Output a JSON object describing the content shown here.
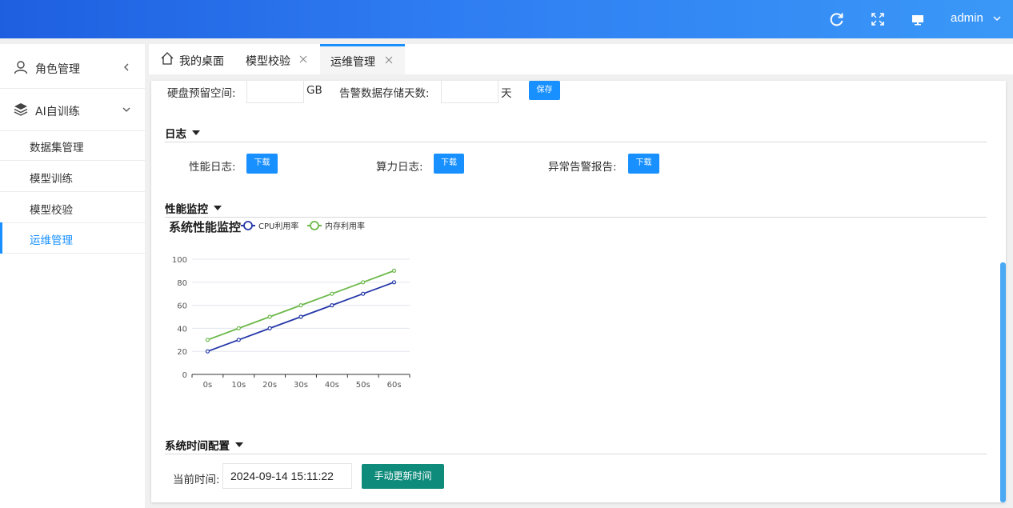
{
  "header": {
    "user": "admin",
    "icons": [
      "refresh-icon",
      "fullscreen-icon",
      "monitor-icon",
      "chevron-down-icon"
    ]
  },
  "sidebar": {
    "role_mgmt": "角色管理",
    "ai_training": "AI自训练",
    "items": [
      "数据集管理",
      "模型训练",
      "模型校验",
      "运维管理"
    ],
    "active_index": 3
  },
  "tabs": [
    {
      "label": "我的桌面",
      "closable": false
    },
    {
      "label": "模型校验",
      "closable": true
    },
    {
      "label": "运维管理",
      "closable": true,
      "active": true
    }
  ],
  "storage": {
    "disk_label": "硬盘预留空间:",
    "disk_value": "",
    "disk_unit": "GB",
    "alarm_label": "告警数据存储天数:",
    "alarm_value": "",
    "alarm_unit": "天",
    "save_label": "保存"
  },
  "log_section": {
    "title": "日志",
    "perf_label": "性能日志:",
    "compute_label": "算力日志:",
    "alarm_label": "异常告警报告:",
    "download_label": "下载"
  },
  "monitor_section": {
    "title": "性能监控"
  },
  "chart_data": {
    "type": "line",
    "title": "系统性能监控",
    "categories": [
      "0s",
      "10s",
      "20s",
      "30s",
      "40s",
      "50s",
      "60s"
    ],
    "series": [
      {
        "name": "CPU利用率",
        "values": [
          20,
          30,
          40,
          50,
          60,
          70,
          80
        ],
        "color": "#2437a8"
      },
      {
        "name": "内存利用率",
        "values": [
          30,
          40,
          50,
          60,
          70,
          80,
          90
        ],
        "color": "#6cb84a"
      }
    ],
    "ylim": [
      0,
      100
    ],
    "yticks": [
      0,
      20,
      40,
      60,
      80,
      100
    ],
    "grid": true,
    "legend_placement": "top"
  },
  "time_section": {
    "title": "系统时间配置",
    "current_label": "当前时间:",
    "current_value": "2024-09-14 15:11:22",
    "update_button": "手动更新时间"
  }
}
